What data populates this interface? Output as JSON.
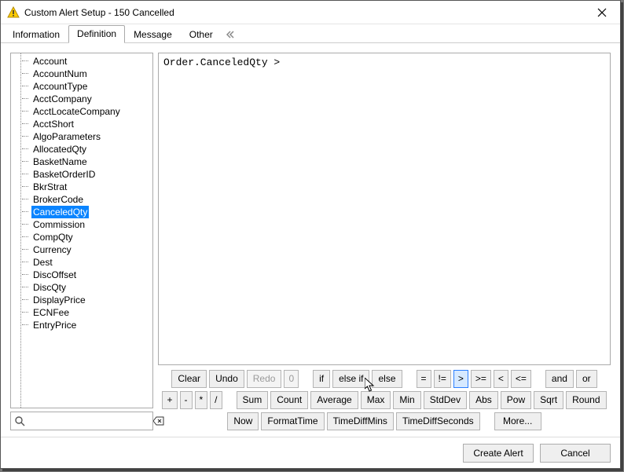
{
  "window": {
    "title": "Custom Alert Setup - 150 Cancelled"
  },
  "tabs": [
    {
      "label": "Information",
      "active": false
    },
    {
      "label": "Definition",
      "active": true
    },
    {
      "label": "Message",
      "active": false
    },
    {
      "label": "Other",
      "active": false
    }
  ],
  "tree": {
    "selected": "CanceledQty",
    "items": [
      "Account",
      "AccountNum",
      "AccountType",
      "AcctCompany",
      "AcctLocateCompany",
      "AcctShort",
      "AlgoParameters",
      "AllocatedQty",
      "BasketName",
      "BasketOrderID",
      "BkrStrat",
      "BrokerCode",
      "CanceledQty",
      "Commission",
      "CompQty",
      "Currency",
      "Dest",
      "DiscOffset",
      "DiscQty",
      "DisplayPrice",
      "ECNFee",
      "EntryPrice"
    ]
  },
  "search": {
    "value": "",
    "placeholder": ""
  },
  "editor": {
    "text": "Order.CanceledQty >"
  },
  "buttonRows": {
    "row1": {
      "clear": "Clear",
      "undo": "Undo",
      "redo": "Redo",
      "redoCount": "0",
      "if": "if",
      "elseif": "else if",
      "else": "else",
      "eq": "=",
      "neq": "!=",
      "gt": ">",
      "gte": ">=",
      "lt": "<",
      "lte": "<=",
      "and": "and",
      "or": "or"
    },
    "row2": {
      "plus": "+",
      "minus": "-",
      "mul": "*",
      "div": "/",
      "sum": "Sum",
      "count": "Count",
      "avg": "Average",
      "max": "Max",
      "min": "Min",
      "stddev": "StdDev",
      "abs": "Abs",
      "pow": "Pow",
      "sqrt": "Sqrt",
      "round": "Round"
    },
    "row3": {
      "now": "Now",
      "fmt": "FormatTime",
      "tdm": "TimeDiffMins",
      "tds": "TimeDiffSeconds",
      "more": "More..."
    }
  },
  "footer": {
    "create": "Create Alert",
    "cancel": "Cancel"
  }
}
